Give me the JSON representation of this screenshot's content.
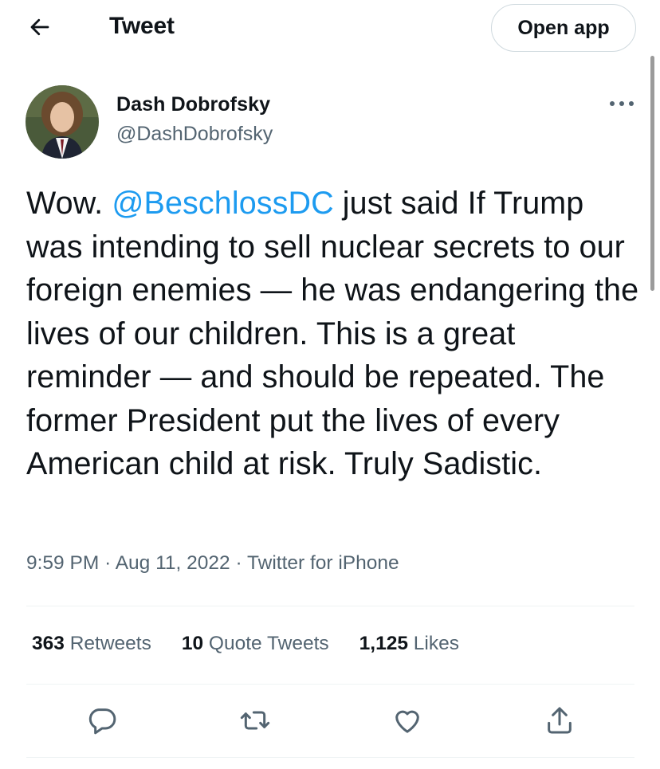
{
  "header": {
    "title": "Tweet",
    "open_app_label": "Open app",
    "back_icon": "arrow-left-icon"
  },
  "author": {
    "display_name": "Dash Dobrofsky",
    "handle": "@DashDobrofsky",
    "avatar": "profile-photo"
  },
  "tweet": {
    "text_before": "Wow. ",
    "mention": "@BeschlossDC",
    "text_after": " just said If Trump was intending to sell nuclear secrets to our foreign enemies — he was endangering the lives of our children. This is a great reminder — and should be repeated. The former President put the lives of every American child at risk. Truly Sadistic.",
    "time": "9:59 PM",
    "separator": "·",
    "date": "Aug 11, 2022",
    "source": "Twitter for iPhone"
  },
  "stats": {
    "retweets_count": "363",
    "retweets_label": "Retweets",
    "quotes_count": "10",
    "quotes_label": "Quote Tweets",
    "likes_count": "1,125",
    "likes_label": "Likes"
  },
  "actions": [
    "reply-icon",
    "retweet-icon",
    "like-icon",
    "share-icon"
  ],
  "colors": {
    "text": "#0f1419",
    "secondary": "#536471",
    "link": "#1d9bf0",
    "divider": "#eff3f4"
  }
}
